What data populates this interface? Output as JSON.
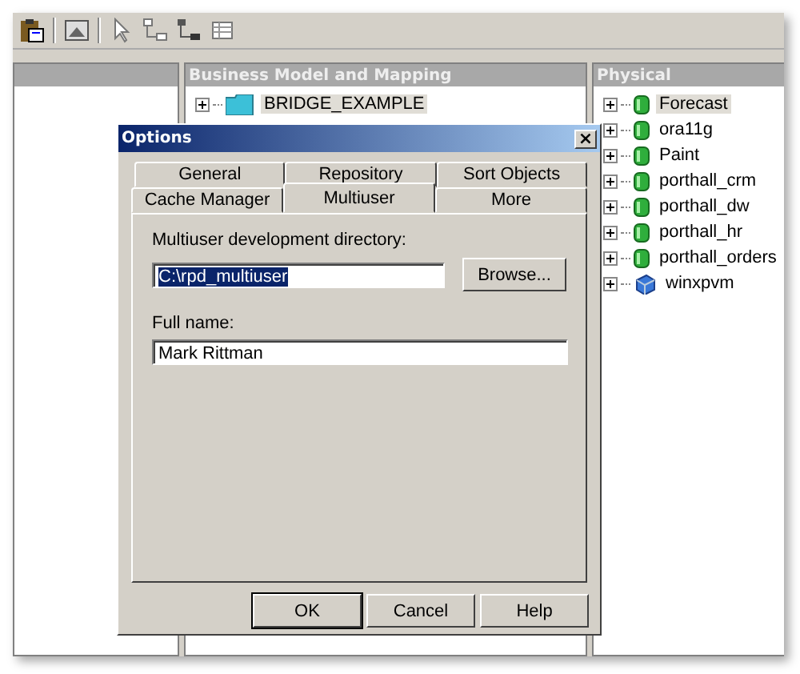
{
  "business_model": {
    "title": "Business Model and Mapping",
    "items": [
      {
        "label": "BRIDGE_EXAMPLE",
        "selected": true,
        "kind": "folder"
      }
    ]
  },
  "physical": {
    "title": "Physical",
    "items": [
      {
        "label": "Forecast",
        "selected": true,
        "kind": "database"
      },
      {
        "label": "ora11g",
        "selected": false,
        "kind": "database"
      },
      {
        "label": "Paint",
        "selected": false,
        "kind": "database"
      },
      {
        "label": "porthall_crm",
        "selected": false,
        "kind": "database"
      },
      {
        "label": "porthall_dw",
        "selected": false,
        "kind": "database"
      },
      {
        "label": "porthall_hr",
        "selected": false,
        "kind": "database"
      },
      {
        "label": "porthall_orders",
        "selected": false,
        "kind": "database"
      },
      {
        "label": "winxpvm",
        "selected": false,
        "kind": "server"
      }
    ]
  },
  "dialog": {
    "title": "Options",
    "close": "×",
    "tab_rows": [
      [
        {
          "label": "General",
          "selected": false
        },
        {
          "label": "Repository",
          "selected": false
        },
        {
          "label": "Sort Objects",
          "selected": false
        }
      ],
      [
        {
          "label": "Cache Manager",
          "selected": false
        },
        {
          "label": "Multiuser",
          "selected": true
        },
        {
          "label": "More",
          "selected": false
        }
      ]
    ],
    "directory_label": "Multiuser development directory:",
    "directory_value": "C:\\rpd_multiuser",
    "directory_highlighted": true,
    "browse": "Browse...",
    "full_name_label": "Full name:",
    "full_name_value": "Mark Rittman",
    "buttons": [
      "OK",
      "Cancel",
      "Help"
    ]
  }
}
